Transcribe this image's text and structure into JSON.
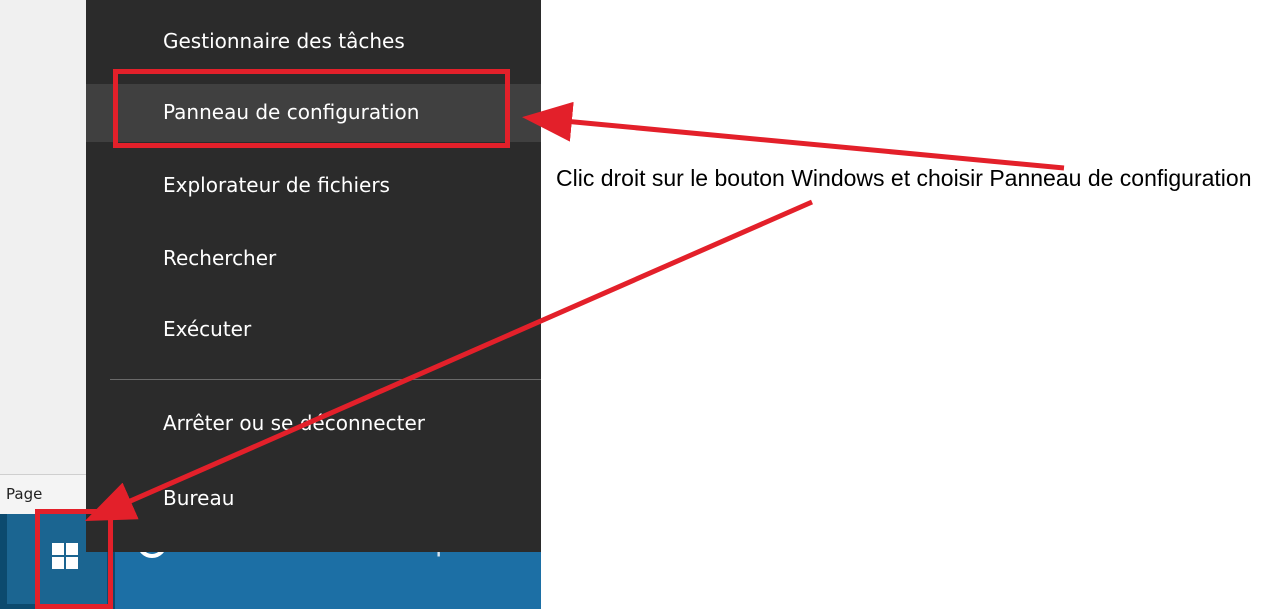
{
  "background_app": {
    "status_label": "Page"
  },
  "taskbar": {
    "start_icon": "windows-logo-icon",
    "search_icon": "cortana-icon",
    "search_placeholder": "Demandez-moi n'impo"
  },
  "context_menu": {
    "items": [
      {
        "label": "Gestionnaire des tâches"
      },
      {
        "label": "Panneau de configuration"
      },
      {
        "label": "Explorateur de fichiers"
      },
      {
        "label": "Rechercher"
      },
      {
        "label": "Exécuter"
      },
      {
        "label": "Arrêter ou se déconnecter"
      },
      {
        "label": "Bureau"
      }
    ],
    "hovered_item": "Panneau de configuration"
  },
  "annotation": {
    "callout_text": "Clic droit sur le bouton Windows et choisir Panneau de configuration",
    "highlight_color": "#e3202a"
  }
}
